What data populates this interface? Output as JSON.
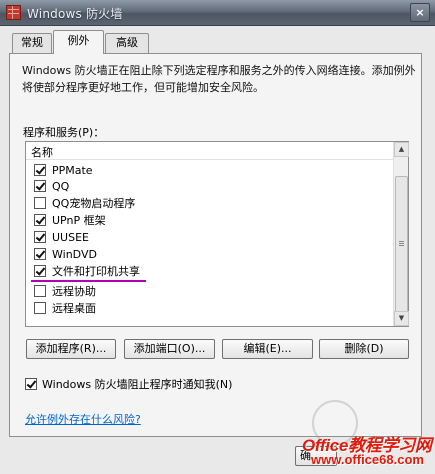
{
  "window": {
    "title": "Windows 防火墙",
    "close_label": "×"
  },
  "tabs": [
    {
      "label": "常规",
      "active": false
    },
    {
      "label": "例外",
      "active": true
    },
    {
      "label": "高级",
      "active": false
    }
  ],
  "exceptions": {
    "description": "Windows 防火墙正在阻止除下列选定程序和服务之外的传入网络连接。添加例外将使部分程序更好地工作，但可能增加安全风险。",
    "list_label": "程序和服务(P)：",
    "column_header": "名称",
    "items": [
      {
        "label": "PPMate",
        "checked": true
      },
      {
        "label": "QQ",
        "checked": true
      },
      {
        "label": "QQ宠物启动程序",
        "checked": false
      },
      {
        "label": "UPnP 框架",
        "checked": true
      },
      {
        "label": "UUSEE",
        "checked": true
      },
      {
        "label": "WinDVD",
        "checked": true
      },
      {
        "label": "文件和打印机共享",
        "checked": true
      },
      {
        "label": "远程协助",
        "checked": false
      },
      {
        "label": "远程桌面",
        "checked": false
      }
    ],
    "buttons": {
      "add_program": "添加程序(R)...",
      "add_port": "添加端口(O)...",
      "edit": "编辑(E)...",
      "delete": "删除(D)"
    },
    "notify_label": "Windows 防火墙阻止程序时通知我(N)",
    "notify_checked": true,
    "risk_link": "允许例外存在什么风险?"
  },
  "bottom": {
    "ok_partial": "确"
  },
  "watermark": {
    "title": "Office教程学习网",
    "url": "www.office68.com"
  },
  "colors": {
    "highlight_underline": "#b000b0",
    "link": "#0066cc",
    "watermark_red": "#e11a0c"
  }
}
